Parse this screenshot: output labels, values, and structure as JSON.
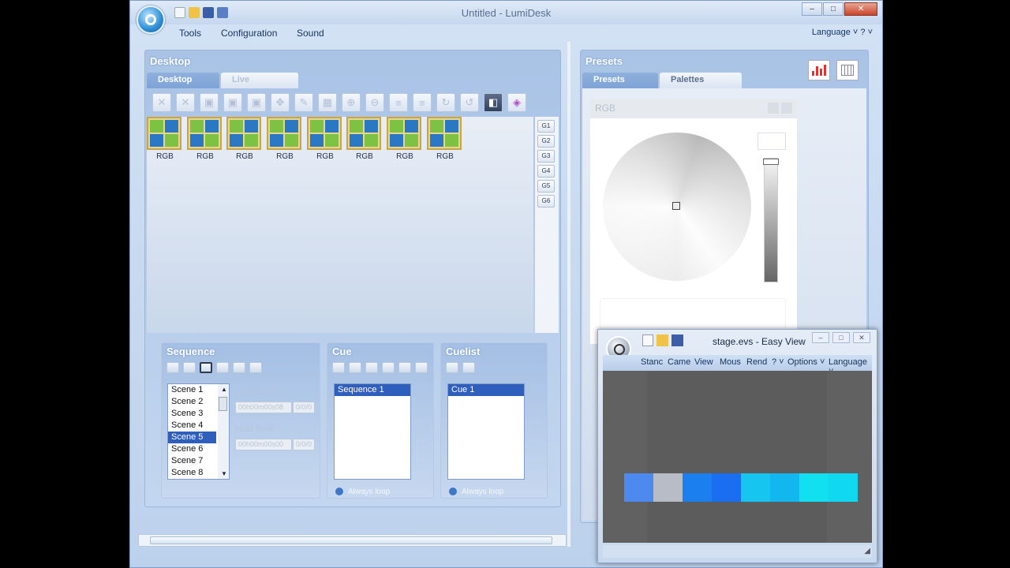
{
  "window": {
    "title": "Untitled - LumiDesk",
    "controls": {
      "minimize": "–",
      "maximize": "□",
      "close": "✕"
    }
  },
  "menu": {
    "tools": "Tools",
    "configuration": "Configuration",
    "sound": "Sound",
    "language": "Language ˅  ? ˅"
  },
  "desktop": {
    "title": "Desktop",
    "tabs": {
      "desktop": "Desktop",
      "live": "Live"
    },
    "toolbar_icons": [
      "close-icon",
      "cancel-icon",
      "shape-icon",
      "shape-icon",
      "shape-icon",
      "move-icon",
      "pen-icon",
      "grid-icon",
      "zoom-icon",
      "zoom-icon",
      "align-icon",
      "align-icon",
      "rotate-icon",
      "rotate-icon",
      "palette-icon",
      "color-icon"
    ],
    "fixtures": [
      "RGB",
      "RGB",
      "RGB",
      "RGB",
      "RGB",
      "RGB",
      "RGB",
      "RGB"
    ],
    "groups": [
      "G1",
      "G2",
      "G3",
      "G4",
      "G5",
      "G6"
    ]
  },
  "sequence": {
    "title": "Sequence",
    "scenes": [
      "Scene 1",
      "Scene 2",
      "Scene 3",
      "Scene 4",
      "Scene 5",
      "Scene 6",
      "Scene 7",
      "Scene 8"
    ],
    "selected_index": 4,
    "fade_label": "Fade Time",
    "fade_value": "00h00m00s08",
    "fade_unit": "0/0/0",
    "hold_label": "Hold Time",
    "hold_value": "00h00m00s00",
    "hold_unit": "0/0/0"
  },
  "cue": {
    "title": "Cue",
    "items": [
      "Sequence 1"
    ],
    "always_loop": "Always loop"
  },
  "cuelist": {
    "title": "Cuelist",
    "items": [
      "Cue 1"
    ],
    "always_loop": "Always loop"
  },
  "presets": {
    "title": "Presets",
    "tabs": {
      "presets": "Presets",
      "palettes": "Palettes"
    },
    "rgb_title": "RGB"
  },
  "easyview": {
    "title": "stage.evs - Easy View",
    "menu": [
      "Stanc",
      "Came",
      "View",
      "Mous",
      "Rend",
      "? ˅",
      "Options ˅",
      "Language ˅"
    ],
    "controls": {
      "minimize": "–",
      "maximize": "□",
      "close": "✕"
    },
    "cells": [
      "#4d8af0",
      "#b7bcc7",
      "#1c7ff0",
      "#1a6ef0",
      "#16c6f0",
      "#12b7f0",
      "#10e0f0",
      "#10d8f0"
    ]
  }
}
